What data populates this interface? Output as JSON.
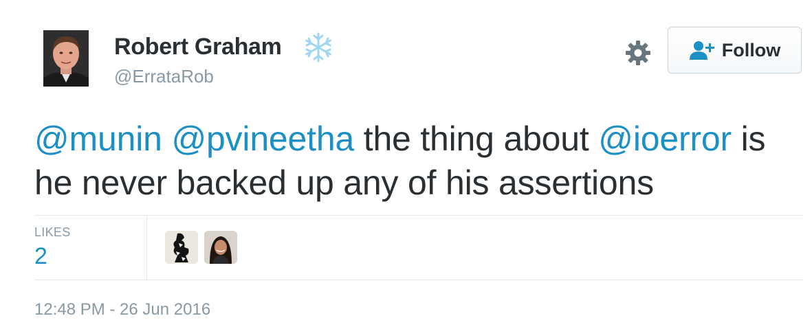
{
  "user": {
    "name": "Robert Graham",
    "handle": "@ErrataRob",
    "badge_icon": "snowflake-icon"
  },
  "actions": {
    "settings_icon": "gear-icon",
    "follow_label": "Follow",
    "follow_icon": "add-user-icon"
  },
  "tweet": {
    "segments": [
      {
        "type": "mention",
        "text": "@munin"
      },
      {
        "type": "text",
        "text": " "
      },
      {
        "type": "mention",
        "text": "@pvineetha"
      },
      {
        "type": "text",
        "text": " the thing about "
      },
      {
        "type": "mention",
        "text": "@ioerror"
      },
      {
        "type": "text",
        "text": " is he never backed up any of his assertions"
      }
    ]
  },
  "stats": {
    "likes_label": "LIKES",
    "likes_count": "2"
  },
  "timestamp": "12:48 PM - 26 Jun 2016",
  "colors": {
    "link": "#1c8fc4",
    "text": "#292f33",
    "muted": "#8899a6",
    "badge": "#9fd6f2"
  }
}
